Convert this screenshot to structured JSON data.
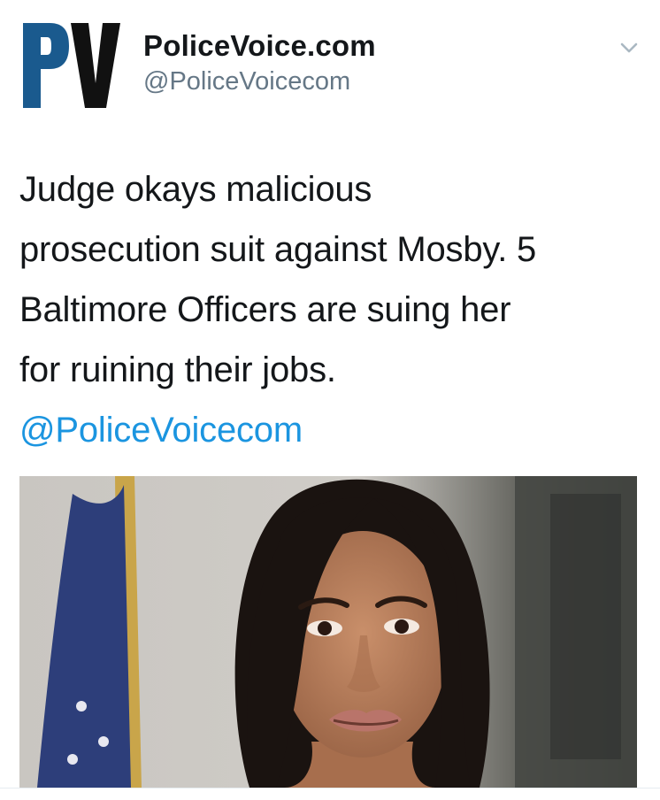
{
  "account": {
    "logo_text": "PV",
    "display_name": "PoliceVoice.com",
    "handle": "@PoliceVoicecom"
  },
  "tweet": {
    "lines": [
      "Judge okays malicious",
      "prosecution suit against Mosby. 5",
      "Baltimore Officers are suing her",
      "for ruining their jobs."
    ],
    "mention": "@PoliceVoicecom"
  },
  "colors": {
    "logo_blue": "#1a5a8e",
    "logo_black": "#111111",
    "link": "#1b95e0",
    "text": "#14171a",
    "secondary": "#657786"
  },
  "icons": {
    "more": "chevron-down-icon"
  }
}
